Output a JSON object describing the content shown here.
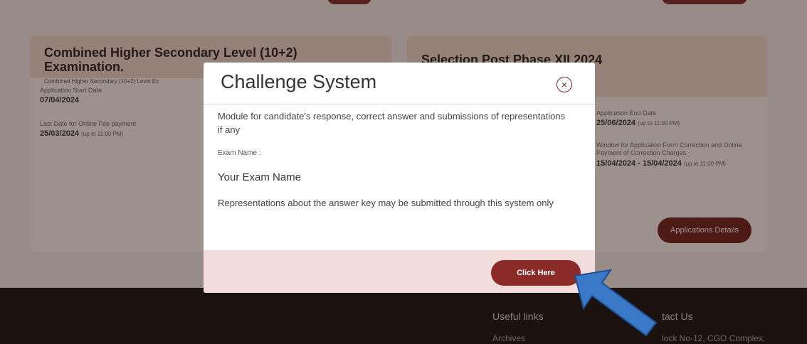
{
  "cards": [
    {
      "title": "Combined Higher Secondary Level (10+2) Examination.",
      "subtitle": "Combined Higher Secondary (10+2) Level Ex",
      "fields": [
        {
          "label": "Application Start Date",
          "value": "07/04/2024",
          "note": ""
        },
        {
          "label": "Last Date for Online Fee payment",
          "value": "25/03/2024",
          "note": "(up to 11:00 PM)"
        }
      ]
    },
    {
      "title": "Selection Post Phase XII 2024",
      "fields": [
        {
          "label": "Application End Date",
          "value": "25/06/2024",
          "note": "(up to 11:00 PM)"
        },
        {
          "label": "Window for Application Form Correction and Online Payment of Correction Charges",
          "value": "15/04/2024 - 15/04/2024",
          "note": "(up to 11:00 PM)"
        }
      ],
      "button": "Applications Details"
    }
  ],
  "footer": {
    "useful_links_heading": "Useful links",
    "archives_link": "Archives",
    "contact_heading": "tact Us",
    "address": "lock No-12, CGO Complex,"
  },
  "modal": {
    "title": "Challenge System",
    "close_symbol": "×",
    "description": "Module for candidate's response, correct answer and submissions of representations if any",
    "exam_name_label": "Exam Name :",
    "exam_name_value": "Your Exam Name",
    "representation_note": "Representations about the answer key may be submitted through this system only",
    "click_button": "Click Here"
  },
  "colors": {
    "accent": "#8a2b27",
    "footer_bg": "#111111",
    "modal_footer_bg": "#f3dcdc",
    "arrow": "#3a78c8"
  }
}
